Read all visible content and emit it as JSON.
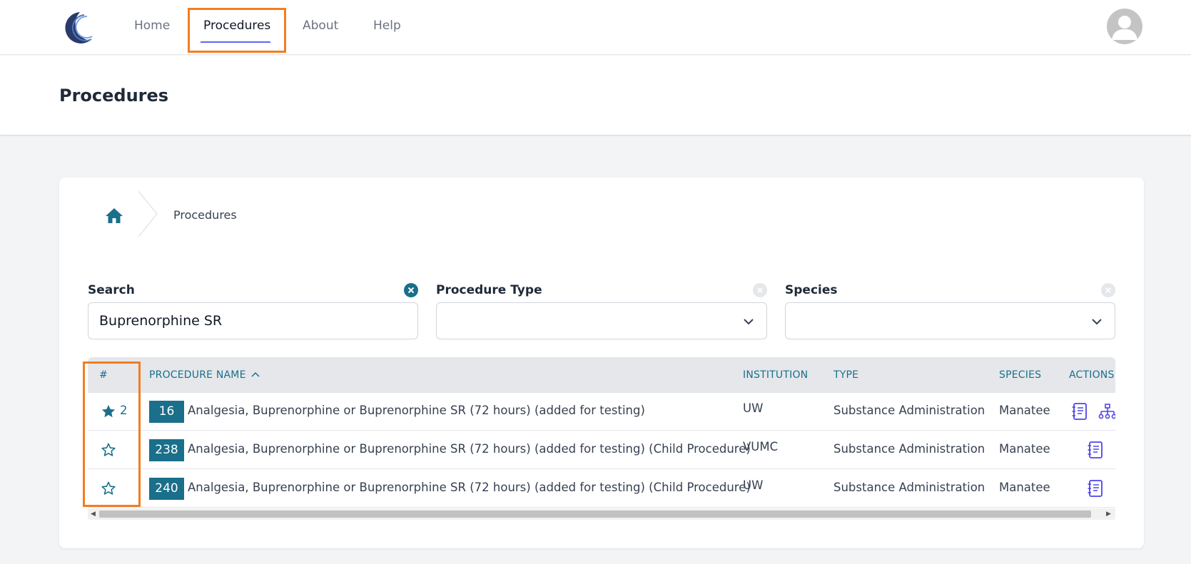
{
  "nav": {
    "items": [
      "Home",
      "Procedures",
      "About",
      "Help"
    ],
    "active": "Procedures"
  },
  "page": {
    "title": "Procedures"
  },
  "breadcrumb": {
    "current": "Procedures"
  },
  "filters": {
    "search": {
      "label": "Search",
      "value": "Buprenorphine SR"
    },
    "procedure_type": {
      "label": "Procedure Type",
      "value": ""
    },
    "species": {
      "label": "Species",
      "value": ""
    }
  },
  "table": {
    "headers": {
      "num": "#",
      "name": "PROCEDURE NAME",
      "institution": "INSTITUTION",
      "type": "TYPE",
      "species": "SPECIES",
      "actions": "ACTIONS"
    },
    "sort_column": "PROCEDURE NAME",
    "sort_direction": "ascending",
    "rows": [
      {
        "starred": true,
        "star_count": "2",
        "id": "16",
        "name": "Analgesia, Buprenorphine or Buprenorphine SR (72 hours) (added for testing)",
        "institution": "UW",
        "type": "Substance Administration",
        "species": "Manatee"
      },
      {
        "starred": false,
        "star_count": "",
        "id": "238",
        "name": "Analgesia, Buprenorphine or Buprenorphine SR (72 hours) (added for testing) (Child Procedure)",
        "institution": "VUMC",
        "type": "Substance Administration",
        "species": "Manatee"
      },
      {
        "starred": false,
        "star_count": "",
        "id": "240",
        "name": "Analgesia, Buprenorphine or Buprenorphine SR (72 hours) (added for testing) (Child Procedure)",
        "institution": "UW",
        "type": "Substance Administration",
        "species": "Manatee"
      }
    ]
  },
  "icons": {
    "logo": "crescent-logo",
    "avatar": "user-avatar-icon",
    "home": "home-icon",
    "clear": "close-circle-icon",
    "dropdown": "chevron-down-icon",
    "star_filled": "star-filled-icon",
    "star_outline": "star-outline-icon",
    "details": "notebook-icon",
    "hierarchy": "sitemap-icon"
  },
  "colors": {
    "accent": "#1a6f8a",
    "nav_underline": "#6366f1",
    "action_icon": "#4f46e5",
    "highlight": "#f37d21"
  }
}
